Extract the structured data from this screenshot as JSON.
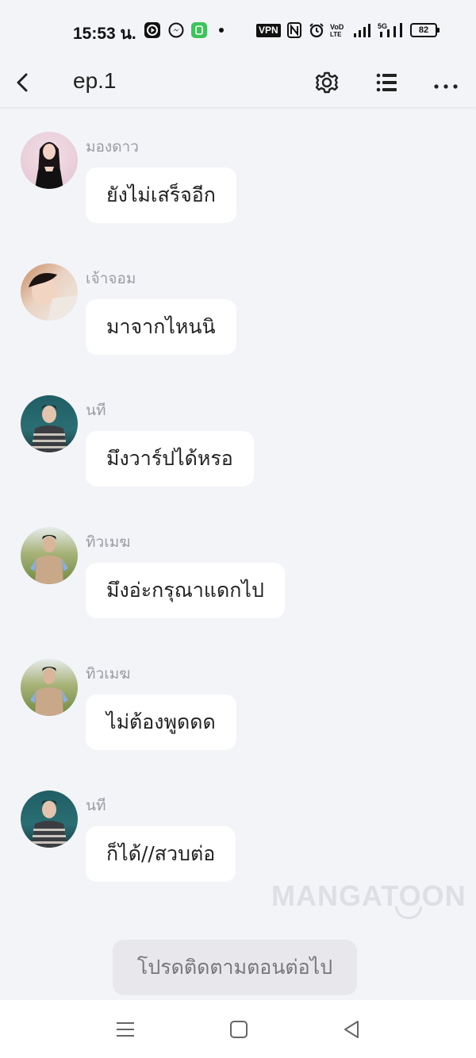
{
  "status_bar": {
    "time": "15:53 น.",
    "vpn_label": "VPN",
    "battery": "82"
  },
  "header": {
    "title": "ep.1",
    "icons": [
      "back-icon",
      "gear-icon",
      "list-icon",
      "more-icon"
    ]
  },
  "messages": [
    {
      "sender": "มองดาว",
      "text": "ยังไม่เสร็จอีก"
    },
    {
      "sender": "เจ้าจอม",
      "text": "มาจากไหนนิ"
    },
    {
      "sender": "นที",
      "text": "มึงวาร์ปได้หรอ"
    },
    {
      "sender": "ทิวเมฆ",
      "text": "มึงอ่ะกรุณาแดกไป"
    },
    {
      "sender": "ทิวเมฆ",
      "text": "ไม่ต้องพูดดด"
    },
    {
      "sender": "นที",
      "text": "ก็ได้//สวบต่อ"
    }
  ],
  "watermark": "MANGATOON",
  "follow_button": "โปรดติดตามตอนต่อไป",
  "nav_bar": {
    "icons": [
      "menu-icon",
      "home-icon",
      "back-triangle-icon"
    ]
  },
  "colors": {
    "background": "#f3f4f8",
    "bubble": "#ffffff",
    "sender_text": "#9a9ca3",
    "follow_button_bg": "#e8e8ec"
  }
}
